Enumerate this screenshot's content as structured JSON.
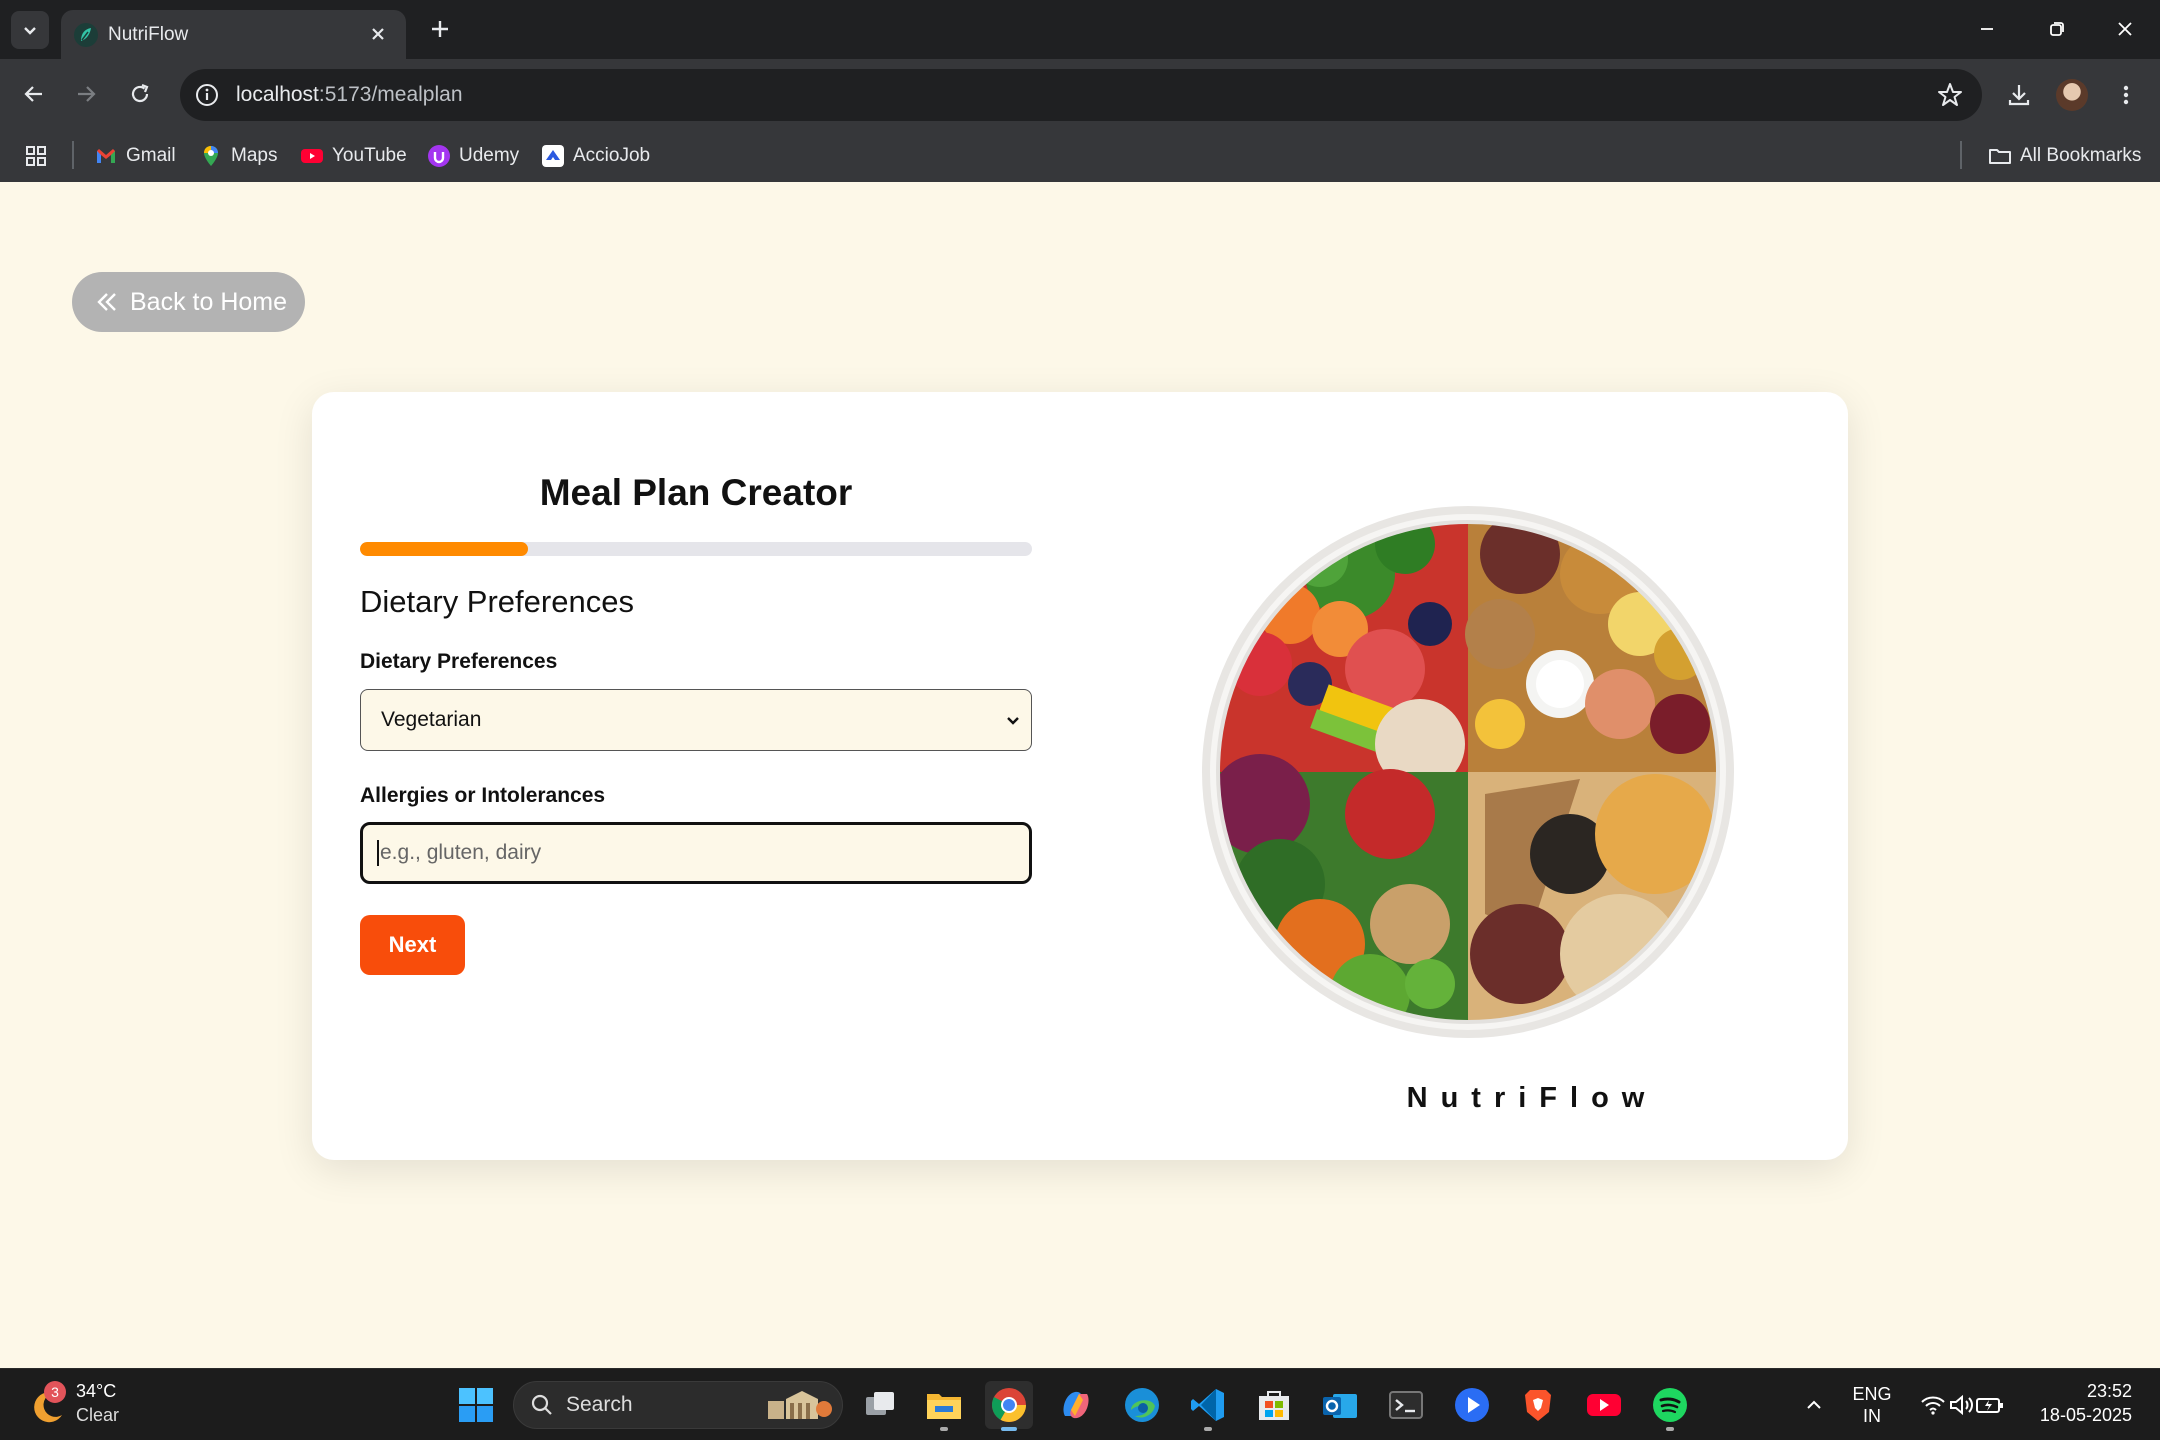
{
  "browser": {
    "tab_title": "NutriFlow",
    "url_host": "localhost",
    "url_path": ":5173/mealplan",
    "bookmarks": [
      {
        "label": "Gmail",
        "icon": "gmail-icon"
      },
      {
        "label": "Maps",
        "icon": "maps-icon"
      },
      {
        "label": "YouTube",
        "icon": "youtube-icon"
      },
      {
        "label": "Udemy",
        "icon": "udemy-icon"
      },
      {
        "label": "AccioJob",
        "icon": "acciojob-icon"
      }
    ],
    "all_bookmarks": "All Bookmarks"
  },
  "page": {
    "back_label": "Back to Home",
    "title": "Meal Plan Creator",
    "progress_fraction": 0.25,
    "section_title": "Dietary Preferences",
    "diet_label": "Dietary Preferences",
    "diet_value": "Vegetarian",
    "allergy_label": "Allergies or Intolerances",
    "allergy_placeholder": "e.g., gluten, dairy",
    "next_label": "Next",
    "brand": "NutriFlow",
    "accent_color": "#f84d0b",
    "progress_color": "#ff8a00"
  },
  "taskbar": {
    "weather_badge": "3",
    "weather_temp": "34°C",
    "weather_condition": "Clear",
    "search_label": "Search",
    "lang_line1": "ENG",
    "lang_line2": "IN",
    "time": "23:52",
    "date": "18-05-2025"
  }
}
